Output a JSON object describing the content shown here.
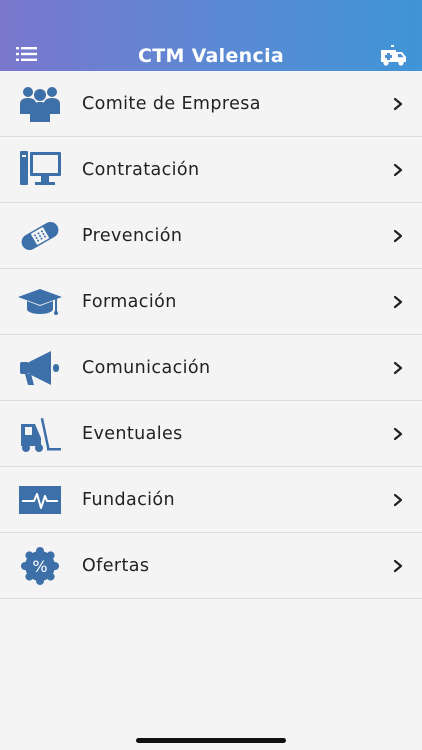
{
  "header": {
    "title": "CTM Valencia"
  },
  "menu": [
    {
      "label": "Comite de Empresa",
      "icon": "people-group-icon"
    },
    {
      "label": "Contratación",
      "icon": "monitor-icon"
    },
    {
      "label": "Prevención",
      "icon": "bandage-icon"
    },
    {
      "label": "Formación",
      "icon": "graduation-cap-icon"
    },
    {
      "label": "Comunicación",
      "icon": "megaphone-icon"
    },
    {
      "label": "Eventuales",
      "icon": "forklift-icon"
    },
    {
      "label": "Fundación",
      "icon": "heartbeat-icon"
    },
    {
      "label": "Ofertas",
      "icon": "discount-badge-icon"
    }
  ],
  "colors": {
    "icon": "#3d6fa8",
    "header_start": "#7a77cd",
    "header_end": "#3f95d6"
  }
}
